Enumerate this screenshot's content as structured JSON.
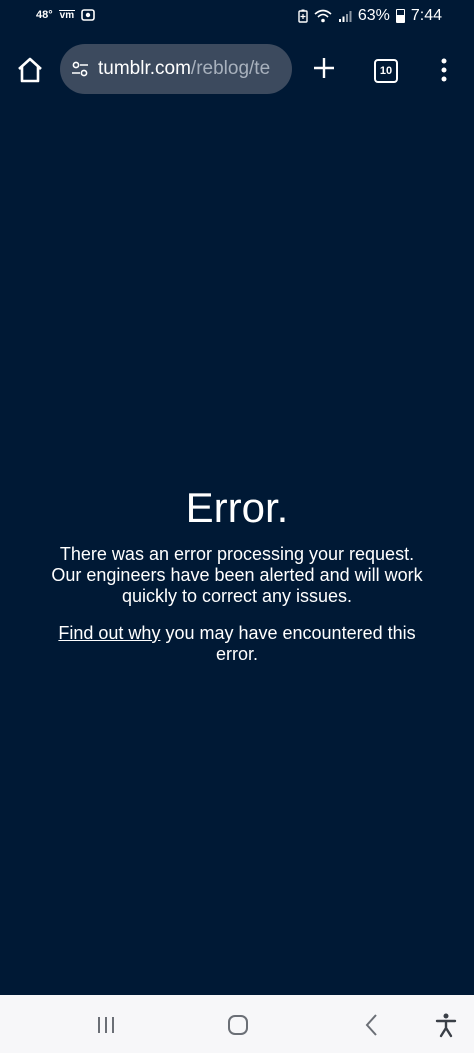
{
  "status_bar": {
    "temperature": "48°",
    "carrier_icon": "vm-icon",
    "screenshot_icon": "screen-record-icon",
    "battery_percent": "63%",
    "time": "7:44"
  },
  "browser": {
    "url_host": "tumblr.com",
    "url_path": "/reblog/te",
    "tab_count": "10"
  },
  "error": {
    "title": "Error.",
    "message_lines": [
      "There was an error processing your request.",
      "Our engineers have been alerted and will work",
      "quickly to correct any issues."
    ],
    "link_text": "Find out why",
    "after_link_line1": " you may have encountered this",
    "after_link_line2": "error."
  },
  "colors": {
    "background": "#001935",
    "url_bar": "#3c4a5e",
    "nav_bar": "#f7f7f9"
  }
}
